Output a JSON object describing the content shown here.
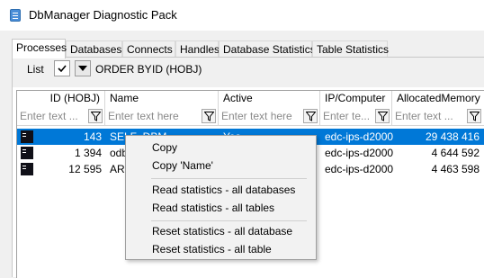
{
  "window": {
    "title": "DbManager Diagnostic Pack"
  },
  "tabs": [
    {
      "label": "Processes",
      "active": true
    },
    {
      "label": "Databases"
    },
    {
      "label": "Connects"
    },
    {
      "label": "Handles"
    },
    {
      "label": "Database Statistics"
    },
    {
      "label": "Table Statistics"
    }
  ],
  "toolbar": {
    "list_label": "List",
    "order_by_label": "ORDER BY",
    "order_by_value": "ID (HOBJ)"
  },
  "grid": {
    "columns": [
      {
        "label": "ID (HOBJ)"
      },
      {
        "label": "Name"
      },
      {
        "label": "Active"
      },
      {
        "label": "IP/Computer"
      },
      {
        "label": "AllocatedMemory"
      }
    ],
    "filter_placeholders": [
      "Enter text ...",
      "Enter text here",
      "Enter text here",
      "Enter te...",
      "Enter text ..."
    ],
    "rows": [
      {
        "id": "143",
        "name": "SELF_DBM",
        "active": "Yes",
        "ip": "edc-ips-d2000",
        "memory": "29 438 416",
        "selected": true
      },
      {
        "id": "1 394",
        "name": "odbc",
        "active": "",
        "ip": "edc-ips-d2000",
        "memory": "4 644 592"
      },
      {
        "id": "12 595",
        "name": "AR.E",
        "active": "",
        "ip": "edc-ips-d2000",
        "memory": "4 463 598"
      }
    ]
  },
  "context_menu": {
    "copy": "Copy",
    "copy_name": "Copy 'Name'",
    "read_all_databases": "Read statistics - all databases",
    "read_all_tables": "Read statistics - all tables",
    "reset_all_database": "Reset statistics - all database",
    "reset_all_table": "Reset statistics - all table"
  }
}
